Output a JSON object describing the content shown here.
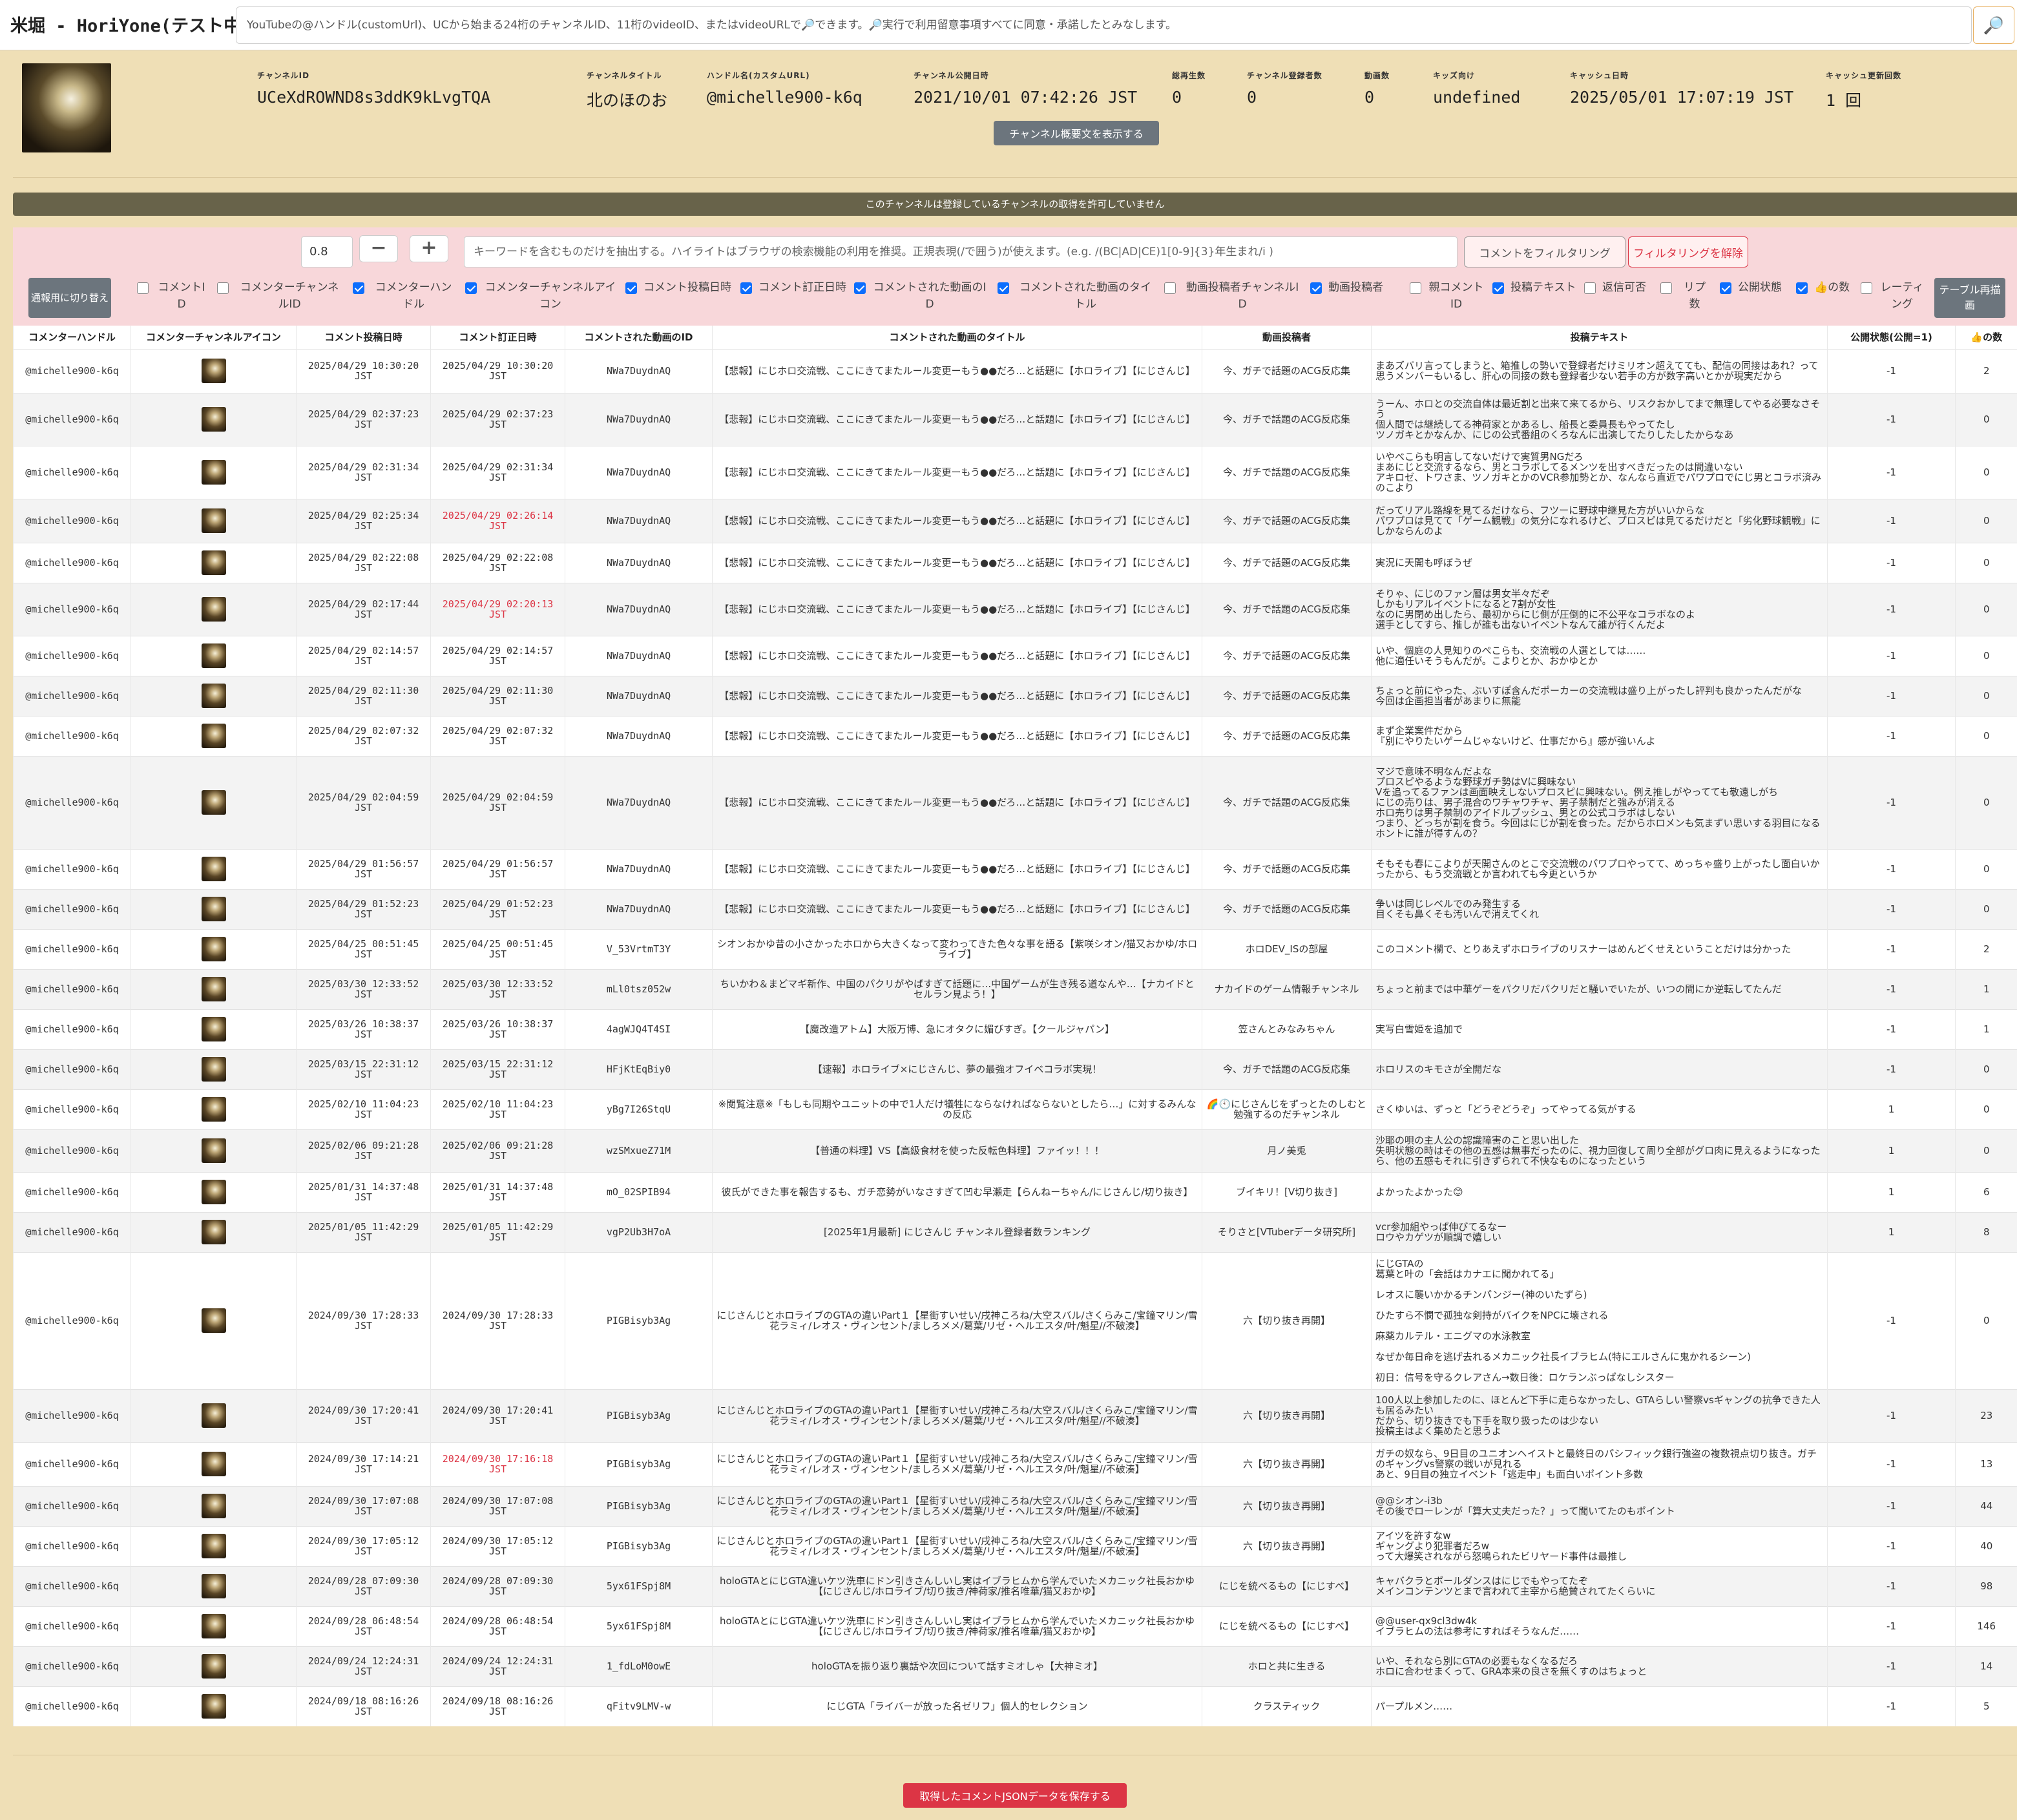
{
  "app": {
    "title": "米堀 - HoriYone(テスト中)",
    "search_placeholder": "YouTubeの@ハンドル(customUrl)、UCから始まる24桁のチャンネルID、11桁のvideoID、またはvideoURLで🔎できます。🔎実行で利用留意事項すべてに同意・承諾したとみなします。",
    "search_icon": "🔎"
  },
  "channel": {
    "fields": [
      {
        "label": "チャンネルID",
        "value": "UCeXdROWND8s3ddK9kLvgTQA"
      },
      {
        "label": "チャンネルタイトル",
        "value": "北のほのお"
      },
      {
        "label": "ハンドル名(カスタムURL)",
        "value": "@michelle900-k6q"
      },
      {
        "label": "チャンネル公開日時",
        "value": "2021/10/01 07:42:26 JST"
      },
      {
        "label": "総再生数",
        "value": "0"
      },
      {
        "label": "チャンネル登録者数",
        "value": "0"
      },
      {
        "label": "動画数",
        "value": "0"
      },
      {
        "label": "キッズ向け",
        "value": "undefined"
      },
      {
        "label": "キャッシュ日時",
        "value": "2025/05/01 17:07:19 JST"
      },
      {
        "label": "キャッシュ更新回数",
        "value": "1 回"
      }
    ],
    "desc_button": "チャンネル概要文を表示する",
    "notice": "このチャンネルは登録しているチャンネルの取得を許可していません"
  },
  "filter": {
    "zoom_value": "0.8",
    "minus_label": "−",
    "plus_label": "+",
    "keyword_placeholder": "キーワードを含むものだけを抽出する。ハイライトはブラウザの検索機能の利用を推奨。正規表現(/で囲う)が使えます。(e.g. /(BC|AD|CE)1[0-9]{3}年生まれ/i )",
    "filter_button": "コメントをフィルタリング",
    "clear_button": "フィルタリングを解除",
    "mobile_button": "通報用に切り替え",
    "redraw_button": "テーブル再描画",
    "checkboxes": [
      {
        "label": "コメントID",
        "checked": false
      },
      {
        "label": "コメンターチャンネルID",
        "checked": false
      },
      {
        "label": "コメンターハンドル",
        "checked": true
      },
      {
        "label": "コメンターチャンネルアイコン",
        "checked": true
      },
      {
        "label": "コメント投稿日時",
        "checked": true
      },
      {
        "label": "コメント訂正日時",
        "checked": true
      },
      {
        "label": "コメントされた動画のID",
        "checked": true
      },
      {
        "label": "コメントされた動画のタイトル",
        "checked": true
      },
      {
        "label": "動画投稿者チャンネルID",
        "checked": false
      },
      {
        "label": "動画投稿者",
        "checked": true
      },
      {
        "label": "親コメントID",
        "checked": false
      },
      {
        "label": "投稿テキスト",
        "checked": true
      },
      {
        "label": "返信可否",
        "checked": false
      },
      {
        "label": "リプ数",
        "checked": false
      },
      {
        "label": "公開状態",
        "checked": true
      },
      {
        "label": "👍の数",
        "checked": true
      },
      {
        "label": "レーティング",
        "checked": false
      }
    ]
  },
  "table": {
    "headers": [
      "コメンターハンドル",
      "コメンターチャンネルアイコン",
      "コメント投稿日時",
      "コメント訂正日時",
      "コメントされた動画のID",
      "コメントされた動画のタイトル",
      "動画投稿者",
      "投稿テキスト",
      "公開状態(公開=1)",
      "👍の数"
    ],
    "rows": [
      {
        "handle": "@michelle900-k6q",
        "posted": "2025/04/29 10:30:20 JST",
        "edited": "2025/04/29 10:30:20 JST",
        "edited_red": false,
        "vid": "NWa7DuydnAQ",
        "title": "【悲報】にじホロ交流戦、ここにきてまたルール変更ーもう●●だろ…と話題に【ホロライブ】【にじさんじ】",
        "author": "今、ガチで話題のACG反応集",
        "text": "まあズバリ言ってしまうと、箱推しの勢いで登録者だけミリオン超えてても、配信の同接はあれ？って思うメンバーもいるし、肝心の同接の数も登録者少ない若手の方が数字高いとかが現実だから",
        "pub": "-1",
        "likes": "2"
      },
      {
        "handle": "@michelle900-k6q",
        "posted": "2025/04/29 02:37:23 JST",
        "edited": "2025/04/29 02:37:23 JST",
        "edited_red": false,
        "vid": "NWa7DuydnAQ",
        "title": "【悲報】にじホロ交流戦、ここにきてまたルール変更ーもう●●だろ…と話題に【ホロライブ】【にじさんじ】",
        "author": "今、ガチで話題のACG反応集",
        "text": "うーん、ホロとの交流自体は最近割と出来て来てるから、リスクおかしてまで無理してやる必要なさそう\n個人間では継続してる神荷家とかあるし、船長と委員長もやってたし\nツノガキとかなんか、にじの公式番組のくろなんに出演してたりしたしたからなあ",
        "pub": "-1",
        "likes": "0"
      },
      {
        "handle": "@michelle900-k6q",
        "posted": "2025/04/29 02:31:34 JST",
        "edited": "2025/04/29 02:31:34 JST",
        "edited_red": false,
        "vid": "NWa7DuydnAQ",
        "title": "【悲報】にじホロ交流戦、ここにきてまたルール変更ーもう●●だろ…と話題に【ホロライブ】【にじさんじ】",
        "author": "今、ガチで話題のACG反応集",
        "text": "いやべこらも明言してないだけで実質男NGだろ\nまあにじと交流するなら、男とコラボしてるメンツを出すべきだったのは間違いない\nアキロゼ、トワさま、ツノガキとかのVCR参加勢とか、なんなら直近でパワプロでにじ男とコラボ済みのこより",
        "pub": "-1",
        "likes": "0"
      },
      {
        "handle": "@michelle900-k6q",
        "posted": "2025/04/29 02:25:34 JST",
        "edited": "2025/04/29 02:26:14 JST",
        "edited_red": true,
        "vid": "NWa7DuydnAQ",
        "title": "【悲報】にじホロ交流戦、ここにきてまたルール変更ーもう●●だろ…と話題に【ホロライブ】【にじさんじ】",
        "author": "今、ガチで話題のACG反応集",
        "text": "だってリアル路線を見てるだけなら、フツーに野球中継見た方がいいからな\nパワプロは見てて「ゲーム観戦」の気分になれるけど、プロスピは見てるだけだと「劣化野球観戦」にしかならんのよ",
        "pub": "-1",
        "likes": "0"
      },
      {
        "handle": "@michelle900-k6q",
        "posted": "2025/04/29 02:22:08 JST",
        "edited": "2025/04/29 02:22:08 JST",
        "edited_red": false,
        "vid": "NWa7DuydnAQ",
        "title": "【悲報】にじホロ交流戦、ここにきてまたルール変更ーもう●●だろ…と話題に【ホロライブ】【にじさんじ】",
        "author": "今、ガチで話題のACG反応集",
        "text": "実況に天開も呼ぼうぜ",
        "pub": "-1",
        "likes": "0"
      },
      {
        "handle": "@michelle900-k6q",
        "posted": "2025/04/29 02:17:44 JST",
        "edited": "2025/04/29 02:20:13 JST",
        "edited_red": true,
        "vid": "NWa7DuydnAQ",
        "title": "【悲報】にじホロ交流戦、ここにきてまたルール変更ーもう●●だろ…と話題に【ホロライブ】【にじさんじ】",
        "author": "今、ガチで話題のACG反応集",
        "text": "そりゃ、にじのファン層は男女半々だぞ\nしかもリアルイベントになると7割が女性\nなのに男閉め出したら、最初からにじ側が圧倒的に不公平なコラボなのよ\n選手としてすら、推しが誰も出ないイベントなんて誰が行くんだよ",
        "pub": "-1",
        "likes": "0"
      },
      {
        "handle": "@michelle900-k6q",
        "posted": "2025/04/29 02:14:57 JST",
        "edited": "2025/04/29 02:14:57 JST",
        "edited_red": false,
        "vid": "NWa7DuydnAQ",
        "title": "【悲報】にじホロ交流戦、ここにきてまたルール変更ーもう●●だろ…と話題に【ホロライブ】【にじさんじ】",
        "author": "今、ガチで話題のACG反応集",
        "text": "いや、個庭の人見知りのぺこらも、交流戦の人選としては……\n他に適任いそうもんだが。こよりとか、おかゆとか",
        "pub": "-1",
        "likes": "0"
      },
      {
        "handle": "@michelle900-k6q",
        "posted": "2025/04/29 02:11:30 JST",
        "edited": "2025/04/29 02:11:30 JST",
        "edited_red": false,
        "vid": "NWa7DuydnAQ",
        "title": "【悲報】にじホロ交流戦、ここにきてまたルール変更ーもう●●だろ…と話題に【ホロライブ】【にじさんじ】",
        "author": "今、ガチで話題のACG反応集",
        "text": "ちょっと前にやった、ぶいすぽ含んだポーカーの交流戦は盛り上がったし評判も良かったんだがな\n今回は企画担当者があまりに無能",
        "pub": "-1",
        "likes": "0"
      },
      {
        "handle": "@michelle900-k6q",
        "posted": "2025/04/29 02:07:32 JST",
        "edited": "2025/04/29 02:07:32 JST",
        "edited_red": false,
        "vid": "NWa7DuydnAQ",
        "title": "【悲報】にじホロ交流戦、ここにきてまたルール変更ーもう●●だろ…と話題に【ホロライブ】【にじさんじ】",
        "author": "今、ガチで話題のACG反応集",
        "text": "まず企業案件だから\n『別にやりたいゲームじゃないけど、仕事だから』感が強いんよ",
        "pub": "-1",
        "likes": "0"
      },
      {
        "handle": "@michelle900-k6q",
        "posted": "2025/04/29 02:04:59 JST",
        "edited": "2025/04/29 02:04:59 JST",
        "edited_red": false,
        "vid": "NWa7DuydnAQ",
        "title": "【悲報】にじホロ交流戦、ここにきてまたルール変更ーもう●●だろ…と話題に【ホロライブ】【にじさんじ】",
        "author": "今、ガチで話題のACG反応集",
        "text": "マジで意味不明なんだよな\nプロスピやるような野球ガチ勢はVに興味ない\nVを追ってるファンは画面映えしないプロスピに興味ない。例え推しがやってても敬遠しがち\nにじの売りは、男子混合のワチャワチャ、男子禁制だと強みが消える\nホロ売りは男子禁制のアイドルプッシュ、男との公式コラボはしない\nつまり、どっちが割を食う。今回はにじが割を食った。だからホロメンも気まずい思いする羽目になる\nホントに誰が得すんの？",
        "pub": "-1",
        "likes": "0"
      },
      {
        "handle": "@michelle900-k6q",
        "posted": "2025/04/29 01:56:57 JST",
        "edited": "2025/04/29 01:56:57 JST",
        "edited_red": false,
        "vid": "NWa7DuydnAQ",
        "title": "【悲報】にじホロ交流戦、ここにきてまたルール変更ーもう●●だろ…と話題に【ホロライブ】【にじさんじ】",
        "author": "今、ガチで話題のACG反応集",
        "text": "そもそも春にこよりが天開さんのとこで交流戦のパワプロやってて、めっちゃ盛り上がったし面白いかったから、もう交流戦とか言われても今更というか",
        "pub": "-1",
        "likes": "0"
      },
      {
        "handle": "@michelle900-k6q",
        "posted": "2025/04/29 01:52:23 JST",
        "edited": "2025/04/29 01:52:23 JST",
        "edited_red": false,
        "vid": "NWa7DuydnAQ",
        "title": "【悲報】にじホロ交流戦、ここにきてまたルール変更ーもう●●だろ…と話題に【ホロライブ】【にじさんじ】",
        "author": "今、ガチで話題のACG反応集",
        "text": "争いは同じレベルでのみ発生する\n目くそも鼻くそも汚いんで消えてくれ",
        "pub": "-1",
        "likes": "0"
      },
      {
        "handle": "@michelle900-k6q",
        "posted": "2025/04/25 00:51:45 JST",
        "edited": "2025/04/25 00:51:45 JST",
        "edited_red": false,
        "vid": "V_53VrtmT3Y",
        "title": "シオンおかゆ昔の小さかったホロから大きくなって変わってきた色々な事を語る【紫咲シオン/猫又おかゆ/ホロライブ】",
        "author": "ホロDEV_ISの部屋",
        "text": "このコメント欄で、とりあえずホロライブのリスナーはめんどくせえということだけは分かった",
        "pub": "-1",
        "likes": "2"
      },
      {
        "handle": "@michelle900-k6q",
        "posted": "2025/03/30 12:33:52 JST",
        "edited": "2025/03/30 12:33:52 JST",
        "edited_red": false,
        "vid": "mLl0tsz052w",
        "title": "ちいかわ＆まどマギ新作、中国のパクリがやばすぎて話題に…中国ゲームが生き残る道なんや…【ナカイドとセルラン見よう！】",
        "author": "ナカイドのゲーム情報チャンネル",
        "text": "ちょっと前までは中華ゲーをパクリだパクリだと騒いでいたが、いつの間にか逆転してたんだ",
        "pub": "-1",
        "likes": "1"
      },
      {
        "handle": "@michelle900-k6q",
        "posted": "2025/03/26 10:38:37 JST",
        "edited": "2025/03/26 10:38:37 JST",
        "edited_red": false,
        "vid": "4agWJQ4T4SI",
        "title": "【魔改造アトム】大阪万博、急にオタクに媚びすぎ。【クールジャパン】",
        "author": "笠さんとみなみちゃん",
        "text": "実写白雪姫を追加で",
        "pub": "-1",
        "likes": "1"
      },
      {
        "handle": "@michelle900-k6q",
        "posted": "2025/03/15 22:31:12 JST",
        "edited": "2025/03/15 22:31:12 JST",
        "edited_red": false,
        "vid": "HFjKtEqBiy0",
        "title": "【速報】ホロライブ×にじさんじ、夢の最強オフイベコラボ実現！",
        "author": "今、ガチで話題のACG反応集",
        "text": "ホロリスのキモさが全開だな",
        "pub": "-1",
        "likes": "0"
      },
      {
        "handle": "@michelle900-k6q",
        "posted": "2025/02/10 11:04:23 JST",
        "edited": "2025/02/10 11:04:23 JST",
        "edited_red": false,
        "vid": "yBg7I26StqU",
        "title": "※閲覧注意※「もしも同期やユニットの中で1人だけ犠牲にならなければならないとしたら…」に対するみんなの反応",
        "author": "🌈🕙にじさんじをずっとたのしむと勉強するのだチャンネル",
        "text": "さくゆいは、ずっと「どうぞどうぞ」ってやってる気がする",
        "pub": "1",
        "likes": "0"
      },
      {
        "handle": "@michelle900-k6q",
        "posted": "2025/02/06 09:21:28 JST",
        "edited": "2025/02/06 09:21:28 JST",
        "edited_red": false,
        "vid": "wzSMxueZ71M",
        "title": "【普通の料理】VS【高級食材を使った反転色料理】ファイッ！！！",
        "author": "月ノ美兎",
        "text": "沙耶の唄の主人公の認識障害のこと思い出した\n失明状態の時はその他の五感は無事だったのに、視力回復して周り全部がグロ肉に見えるようになったら、他の五感もそれに引きずられて不快なものになったという",
        "pub": "1",
        "likes": "0"
      },
      {
        "handle": "@michelle900-k6q",
        "posted": "2025/01/31 14:37:48 JST",
        "edited": "2025/01/31 14:37:48 JST",
        "edited_red": false,
        "vid": "mO_02SPIB94",
        "title": "彼氏ができた事を報告するも、ガチ恋勢がいなさすぎて凹む早瀬走【らんねーちゃん/にじさんじ/切り抜き】",
        "author": "ブイキリ！[V切り抜き]",
        "text": "よかったよかった😊",
        "pub": "1",
        "likes": "6"
      },
      {
        "handle": "@michelle900-k6q",
        "posted": "2025/01/05 11:42:29 JST",
        "edited": "2025/01/05 11:42:29 JST",
        "edited_red": false,
        "vid": "vgP2Ub3H7oA",
        "title": "[2025年1月最新] にじさんじ チャンネル登録者数ランキング",
        "author": "そりさと[VTuberデータ研究所]",
        "text": "vcr参加組やっぱ伸びてるなー\nロウやカゲツが順調で嬉しい",
        "pub": "1",
        "likes": "8"
      },
      {
        "handle": "@michelle900-k6q",
        "posted": "2024/09/30 17:28:33 JST",
        "edited": "2024/09/30 17:28:33 JST",
        "edited_red": false,
        "vid": "PIGBisyb3Ag",
        "title": "にじさんじとホロライブのGTAの違いPart１【星街すいせい/戌神ころね/大空スバル/さくらみこ/宝鐘マリン/雪花ラミィ/レオス・ヴィンセント/ましろメメ/葛葉/リゼ・ヘルエスタ/叶/魁星//不破湊】",
        "author": "六【切り抜き再開】",
        "text": "にじGTAの\n葛葉と叶の「会話はカナエに聞かれてる」\n\nレオスに襲いかかるチンパンジー(神のいたずら)\n\nひたすら不憫で孤独な剣持がバイクをNPCに壊される\n\n麻薬カルテル・エニグマの水泳教室\n\nなぜか毎日命を逃げ去れるメカニック社長イブラヒム(特にエルさんに鬼かれるシーン)\n\n初日：信号を守るクレアさん→数日後：ロケランぶっぱなしシスター",
        "pub": "-1",
        "likes": "0"
      },
      {
        "handle": "@michelle900-k6q",
        "posted": "2024/09/30 17:20:41 JST",
        "edited": "2024/09/30 17:20:41 JST",
        "edited_red": false,
        "vid": "PIGBisyb3Ag",
        "title": "にじさんじとホロライブのGTAの違いPart１【星街すいせい/戌神ころね/大空スバル/さくらみこ/宝鐘マリン/雪花ラミィ/レオス・ヴィンセント/ましろメメ/葛葉/リゼ・ヘルエスタ/叶/魁星//不破湊】",
        "author": "六【切り抜き再開】",
        "text": "100人以上参加したのに、ほとんど下手に走らなかったし、GTAらしい警察vsギャングの抗争できた人も居るみたい\nだから、切り抜きでも下手を取り扱ったのは少ない\n投稿主はよく集めたと思うよ",
        "pub": "-1",
        "likes": "23"
      },
      {
        "handle": "@michelle900-k6q",
        "posted": "2024/09/30 17:14:21 JST",
        "edited": "2024/09/30 17:16:18 JST",
        "edited_red": true,
        "vid": "PIGBisyb3Ag",
        "title": "にじさんじとホロライブのGTAの違いPart１【星街すいせい/戌神ころね/大空スバル/さくらみこ/宝鐘マリン/雪花ラミィ/レオス・ヴィンセント/ましろメメ/葛葉/リゼ・ヘルエスタ/叶/魁星//不破湊】",
        "author": "六【切り抜き再開】",
        "text": "ガチの奴なら、9日目のユニオンヘイストと最終日のパシフィック銀行強盗の複数視点切り抜き。ガチのギャングvs警察の戦いが見れる\nあと、9日目の独立イベント「逃走中」も面白いポイント多数",
        "pub": "-1",
        "likes": "13"
      },
      {
        "handle": "@michelle900-k6q",
        "posted": "2024/09/30 17:07:08 JST",
        "edited": "2024/09/30 17:07:08 JST",
        "edited_red": false,
        "vid": "PIGBisyb3Ag",
        "title": "にじさんじとホロライブのGTAの違いPart１【星街すいせい/戌神ころね/大空スバル/さくらみこ/宝鐘マリン/雪花ラミィ/レオス・ヴィンセント/ましろメメ/葛葉/リゼ・ヘルエスタ/叶/魁星//不破湊】",
        "author": "六【切り抜き再開】",
        "text": "@@シオン-i3b\nその後でローレンが「算大丈夫だった？」って聞いてたのもポイント",
        "pub": "-1",
        "likes": "44"
      },
      {
        "handle": "@michelle900-k6q",
        "posted": "2024/09/30 17:05:12 JST",
        "edited": "2024/09/30 17:05:12 JST",
        "edited_red": false,
        "vid": "PIGBisyb3Ag",
        "title": "にじさんじとホロライブのGTAの違いPart１【星街すいせい/戌神ころね/大空スバル/さくらみこ/宝鐘マリン/雪花ラミィ/レオス・ヴィンセント/ましろメメ/葛葉/リゼ・ヘルエスタ/叶/魁星//不破湊】",
        "author": "六【切り抜き再開】",
        "text": "アイツを許すなw\nギャングより犯罪者だろw\nって大爆笑されながら怒鳴られたビリヤード事件は最推し",
        "pub": "-1",
        "likes": "40"
      },
      {
        "handle": "@michelle900-k6q",
        "posted": "2024/09/28 07:09:30 JST",
        "edited": "2024/09/28 07:09:30 JST",
        "edited_red": false,
        "vid": "5yx61FSpj8M",
        "title": "holoGTAとにじGTA違いケツ洗車にドン引きさんしいし実はイブラヒムから学んでいたメカニック社長おかゆ【にじさんじ/ホロライブ/切り抜き/神荷家/推名唯華/猫又おかゆ】",
        "author": "にじを統べるもの【にじすべ】",
        "text": "キャバクラとポールダンスはにじでもやってたぞ\nメインコンテンツとまで言われて主宰から絶賛されてたくらいに",
        "pub": "-1",
        "likes": "98"
      },
      {
        "handle": "@michelle900-k6q",
        "posted": "2024/09/28 06:48:54 JST",
        "edited": "2024/09/28 06:48:54 JST",
        "edited_red": false,
        "vid": "5yx61FSpj8M",
        "title": "holoGTAとにじGTA違いケツ洗車にドン引きさんしいし実はイブラヒムから学んでいたメカニック社長おかゆ【にじさんじ/ホロライブ/切り抜き/神荷家/推名唯華/猫又おかゆ】",
        "author": "にじを統べるもの【にじすべ】",
        "text": "@@user-qx9cl3dw4k\nイブラヒムの法は参考にすればそうなんだ……",
        "pub": "-1",
        "likes": "146"
      },
      {
        "handle": "@michelle900-k6q",
        "posted": "2024/09/24 12:24:31 JST",
        "edited": "2024/09/24 12:24:31 JST",
        "edited_red": false,
        "vid": "1_fdLoM0owE",
        "title": "holoGTAを振り返り裏話や次回について話すミオしゃ【大神ミオ】",
        "author": "ホロと共に生きる",
        "text": "いや、それなら別にGTAの必要もなくなるだろ\nホロに合わせまくって、GRA本来の良さを無くすのはちょっと",
        "pub": "-1",
        "likes": "14"
      },
      {
        "handle": "@michelle900-k6q",
        "posted": "2024/09/18 08:16:26 JST",
        "edited": "2024/09/18 08:16:26 JST",
        "edited_red": false,
        "vid": "qFitv9LMV-w",
        "title": "にじGTA「ライバーが放った名ゼリフ」個人的セレクション",
        "author": "クラスティック",
        "text": "パープルメン……",
        "pub": "-1",
        "likes": "5"
      }
    ]
  },
  "footer": {
    "save_button": "取得したコメントJSONデータを保存する"
  }
}
